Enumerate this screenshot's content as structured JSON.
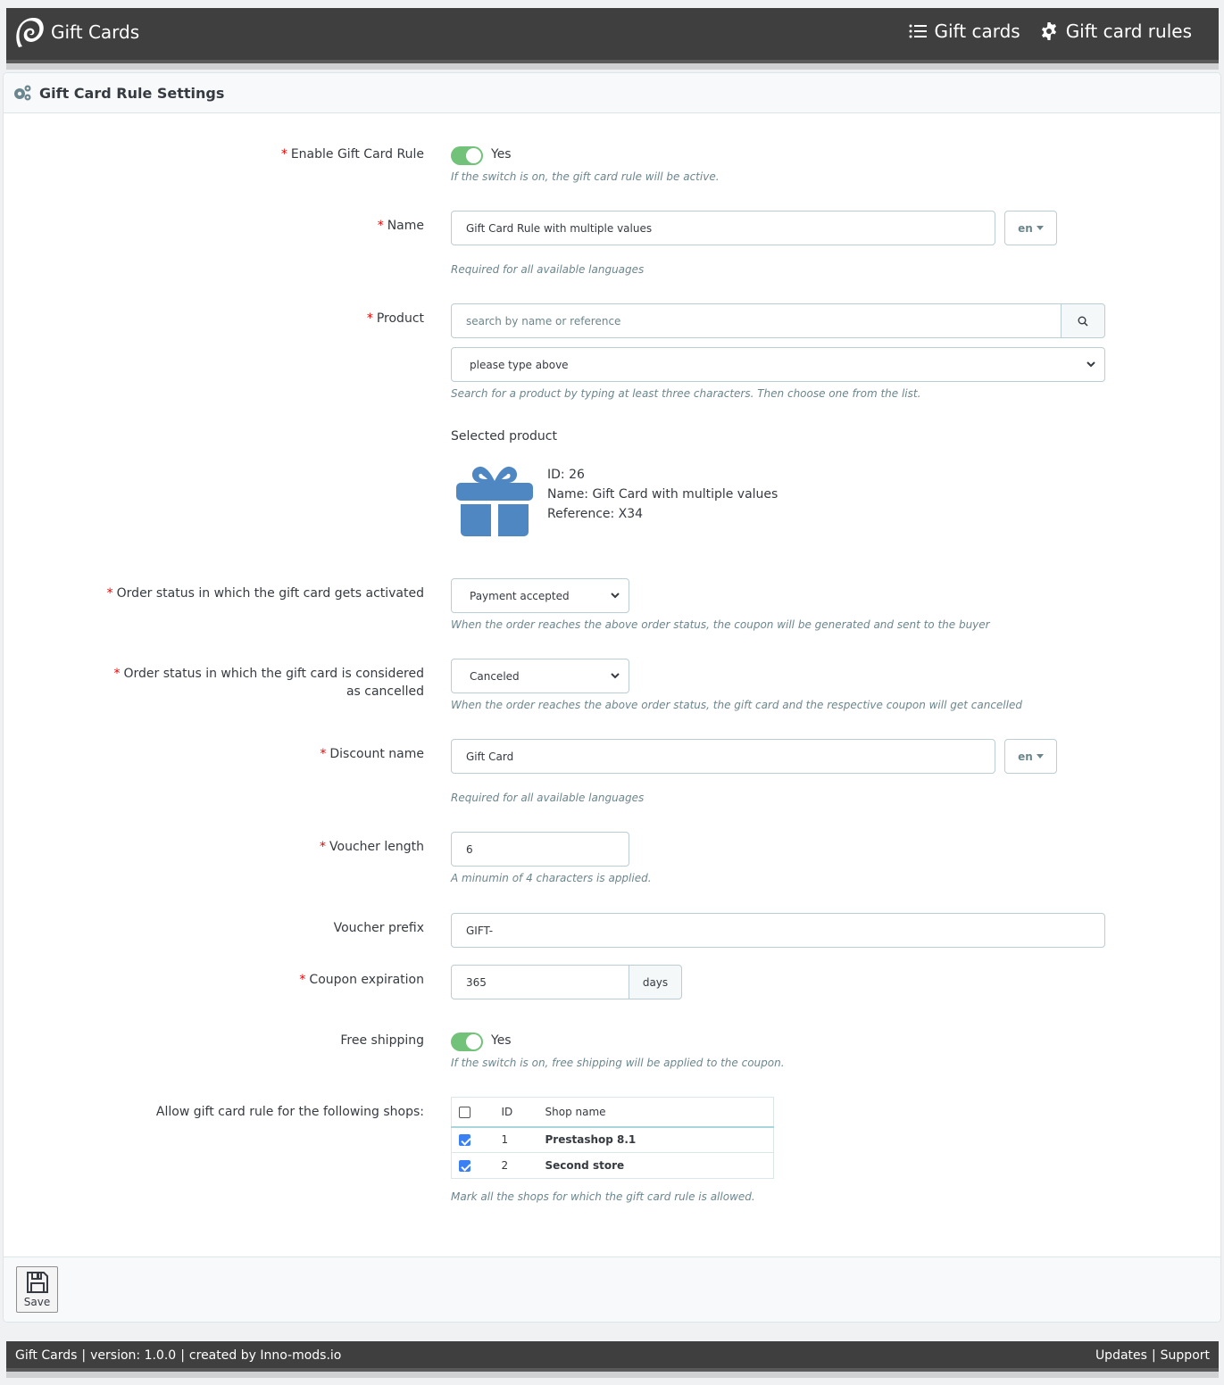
{
  "header": {
    "app_title": "Gift Cards",
    "logo_icon": "swirl-logo-icon",
    "nav": [
      {
        "label": "Gift cards",
        "icon": "list-icon"
      },
      {
        "label": "Gift card rules",
        "icon": "gear-icon"
      }
    ]
  },
  "panel": {
    "title": "Gift Card Rule Settings",
    "title_icon": "gears-icon"
  },
  "form": {
    "enable_rule": {
      "label": "Enable Gift Card Rule",
      "required": true,
      "value": "on",
      "value_label": "Yes",
      "help": "If the switch is on, the gift card rule will be active."
    },
    "name": {
      "label": "Name",
      "required": true,
      "value": "Gift Card Rule with multiple values",
      "language": "en",
      "help": "Required for all available languages"
    },
    "product": {
      "label": "Product",
      "required": true,
      "search_placeholder": "search by name or reference",
      "search_icon": "search-icon",
      "select_value": "please type above",
      "help": "Search for a product by typing at least three characters. Then choose one from the list.",
      "selected_title": "Selected product",
      "selected_icon": "gift-icon",
      "selected_id": "ID: 26",
      "selected_name": "Name: Gift Card with multiple values",
      "selected_reference": "Reference: X34"
    },
    "activation_status": {
      "label": "Order status in which the gift card gets activated",
      "required": true,
      "value": "Payment accepted",
      "help": "When the order reaches the above order status, the coupon will be generated and sent to the buyer"
    },
    "cancel_status": {
      "label": "Order status in which the gift card is considered as cancelled",
      "required": true,
      "value": "Canceled",
      "help": "When the order reaches the above order status, the gift card and the respective coupon will get cancelled"
    },
    "discount_name": {
      "label": "Discount name",
      "required": true,
      "value": "Gift Card",
      "language": "en",
      "help": "Required for all available languages"
    },
    "voucher_length": {
      "label": "Voucher length",
      "required": true,
      "value": "6",
      "help": "A minumin of 4 characters is applied."
    },
    "voucher_prefix": {
      "label": "Voucher prefix",
      "required": false,
      "value": "GIFT-"
    },
    "coupon_expiration": {
      "label": "Coupon expiration",
      "required": true,
      "value": "365",
      "unit": "days"
    },
    "free_shipping": {
      "label": "Free shipping",
      "required": false,
      "value": "on",
      "value_label": "Yes",
      "help": "If the switch is on, free shipping will be applied to the coupon."
    },
    "shops": {
      "label": "Allow gift card rule for the following shops:",
      "columns": [
        "",
        "ID",
        "Shop name"
      ],
      "select_all_checked": false,
      "rows": [
        {
          "checked": true,
          "id": "1",
          "name": "Prestashop 8.1"
        },
        {
          "checked": true,
          "id": "2",
          "name": "Second store"
        }
      ],
      "help": "Mark all the shops for which the gift card rule is allowed."
    }
  },
  "actions": {
    "save_label": "Save",
    "save_icon": "floppy-disk-icon"
  },
  "footer": {
    "app": "Gift Cards",
    "version": "version: 1.0.0",
    "created_by": "created by",
    "author": "Inno-mods.io",
    "links": [
      "Updates",
      "Support"
    ]
  }
}
